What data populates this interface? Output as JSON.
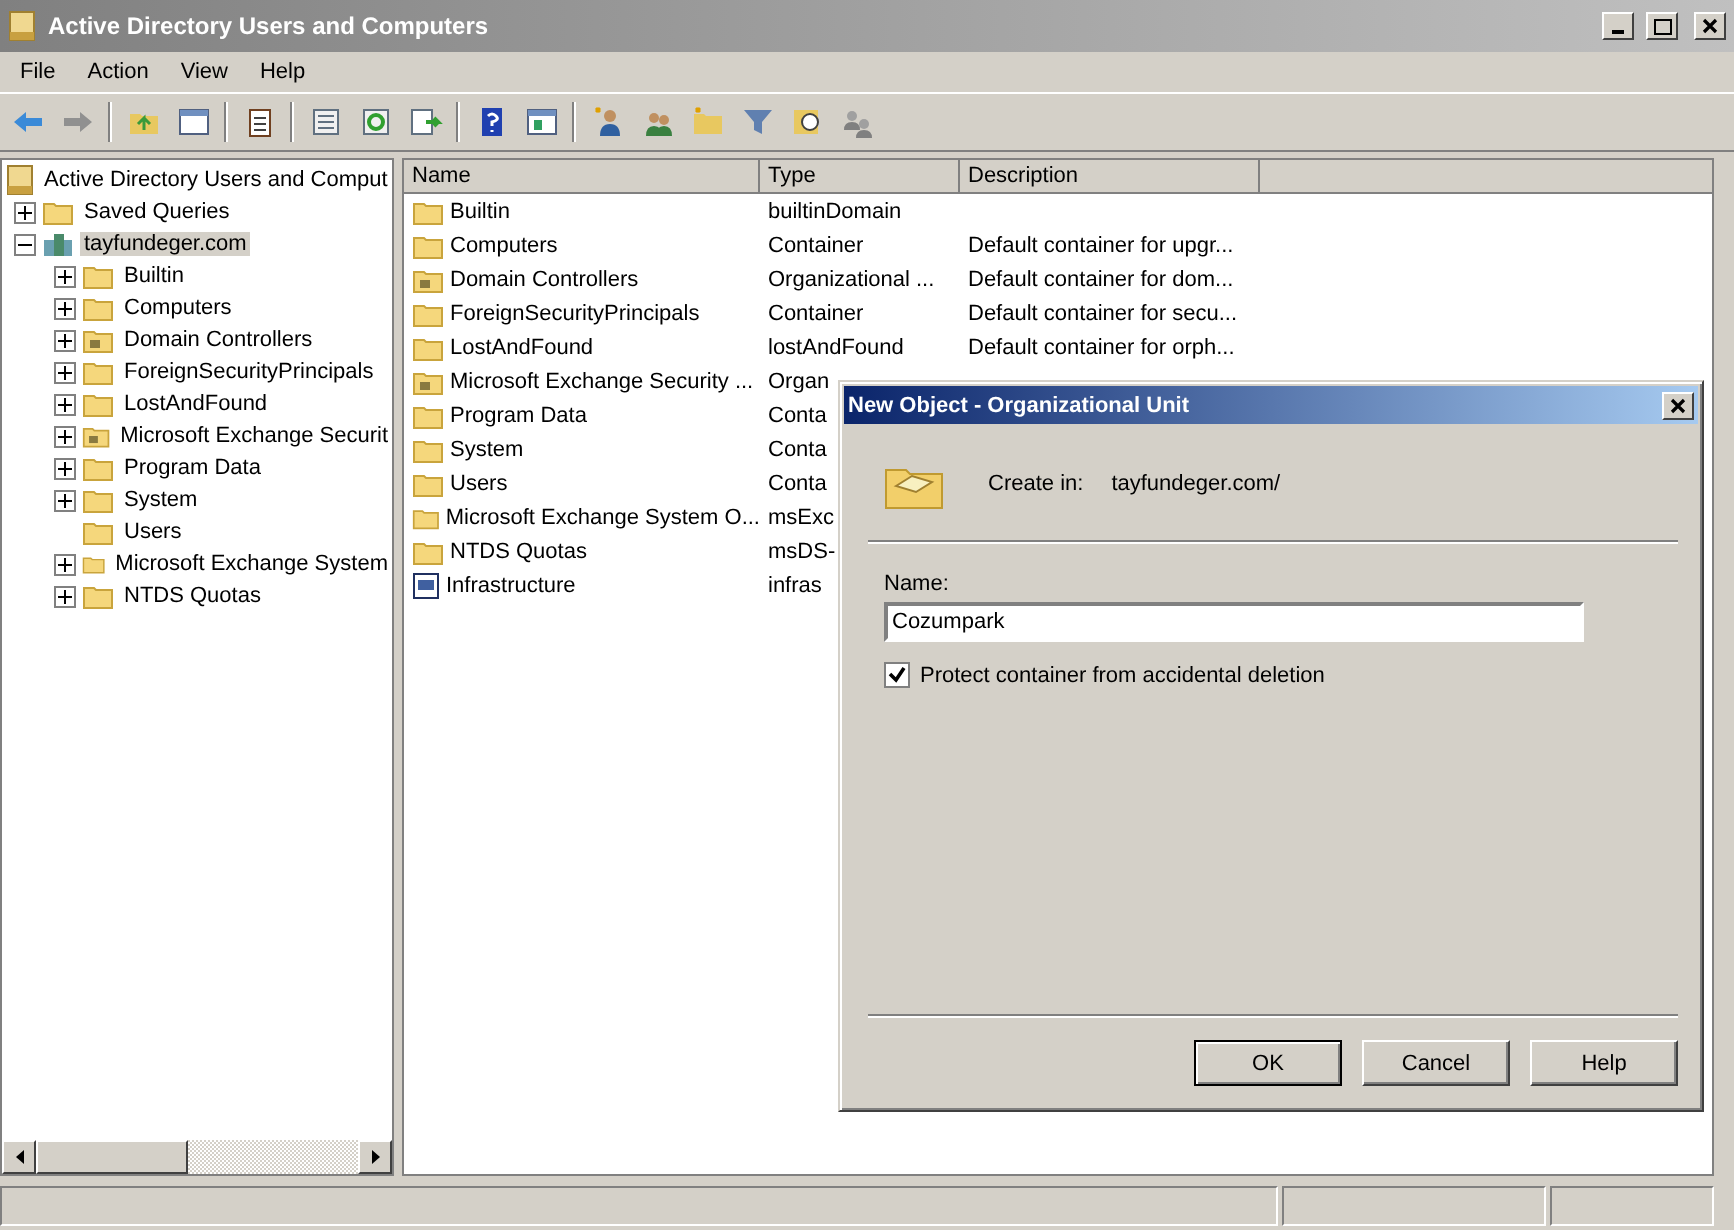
{
  "window": {
    "title": "Active Directory Users and Computers"
  },
  "menu": [
    "File",
    "Action",
    "View",
    "Help"
  ],
  "tree": {
    "label": "Active Directory Users and Comput",
    "kind": "root",
    "children": [
      {
        "label": "Saved Queries",
        "kind": "folder",
        "expandable": true,
        "expanded": false,
        "selected": false
      },
      {
        "label": "tayfundeger.com",
        "kind": "domain",
        "expandable": true,
        "expanded": true,
        "selected": true,
        "children": [
          {
            "label": "Builtin",
            "kind": "folder",
            "expandable": true,
            "expanded": false,
            "selected": false
          },
          {
            "label": "Computers",
            "kind": "folder",
            "expandable": true,
            "expanded": false,
            "selected": false
          },
          {
            "label": "Domain Controllers",
            "kind": "ou",
            "expandable": true,
            "expanded": false,
            "selected": false
          },
          {
            "label": "ForeignSecurityPrincipals",
            "kind": "folder",
            "expandable": true,
            "expanded": false,
            "selected": false
          },
          {
            "label": "LostAndFound",
            "kind": "folder",
            "expandable": true,
            "expanded": false,
            "selected": false
          },
          {
            "label": "Microsoft Exchange Securit",
            "kind": "ou",
            "expandable": true,
            "expanded": false,
            "selected": false
          },
          {
            "label": "Program Data",
            "kind": "folder",
            "expandable": true,
            "expanded": false,
            "selected": false
          },
          {
            "label": "System",
            "kind": "folder",
            "expandable": true,
            "expanded": false,
            "selected": false
          },
          {
            "label": "Users",
            "kind": "folder",
            "expandable": false,
            "selected": false
          },
          {
            "label": "Microsoft Exchange System",
            "kind": "folder",
            "expandable": true,
            "expanded": false,
            "selected": false
          },
          {
            "label": "NTDS Quotas",
            "kind": "folder",
            "expandable": true,
            "expanded": false,
            "selected": false
          }
        ]
      }
    ]
  },
  "list": {
    "columns": [
      "Name",
      "Type",
      "Description"
    ],
    "rows": [
      {
        "kind": "folder",
        "name": "Builtin",
        "type": "builtinDomain"
      },
      {
        "kind": "folder",
        "name": "Computers",
        "type": "Container",
        "description": "Default container for upgr..."
      },
      {
        "kind": "ou",
        "name": "Domain Controllers",
        "type": "Organizational ...",
        "description": "Default container for dom..."
      },
      {
        "kind": "folder",
        "name": "ForeignSecurityPrincipals",
        "type": "Container",
        "description": "Default container for secu..."
      },
      {
        "kind": "folder",
        "name": "LostAndFound",
        "type": "lostAndFound",
        "description": "Default container for orph..."
      },
      {
        "kind": "ou",
        "name": "Microsoft Exchange Security ...",
        "type": "Organ"
      },
      {
        "kind": "folder",
        "name": "Program Data",
        "type": "Conta"
      },
      {
        "kind": "folder",
        "name": "System",
        "type": "Conta"
      },
      {
        "kind": "folder",
        "name": "Users",
        "type": "Conta"
      },
      {
        "kind": "folder",
        "name": "Microsoft Exchange System O...",
        "type": "msExc"
      },
      {
        "kind": "folder",
        "name": "NTDS Quotas",
        "type": "msDS-"
      },
      {
        "kind": "infrastructure",
        "name": "Infrastructure",
        "type": "infras"
      }
    ]
  },
  "dialog": {
    "title": "New Object - Organizational Unit",
    "create_in_label": "Create in:",
    "create_in_value": "tayfundeger.com/",
    "name_label": "Name:",
    "name_value": "Cozumpark",
    "protect": {
      "label": "Protect container from accidental deletion",
      "checked": true
    },
    "buttons": [
      {
        "label": "OK",
        "default": true
      },
      {
        "label": "Cancel",
        "default": false
      },
      {
        "label": "Help",
        "default": false
      }
    ]
  }
}
